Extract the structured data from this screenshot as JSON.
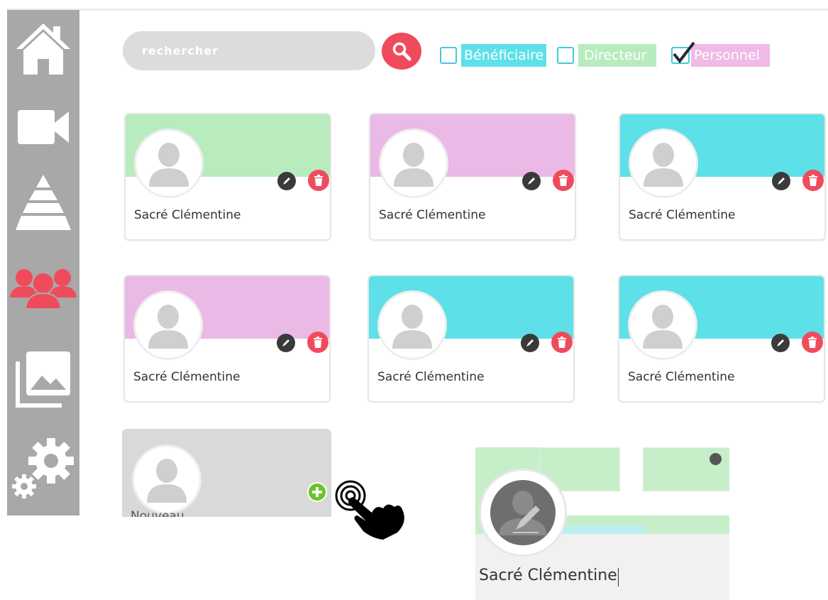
{
  "sidebar": {
    "items": [
      {
        "icon": "home-icon"
      },
      {
        "icon": "video-camera-icon"
      },
      {
        "icon": "pyramid-icon"
      },
      {
        "icon": "users-group-icon",
        "active": true
      },
      {
        "icon": "gallery-icon"
      },
      {
        "icon": "settings-gears-icon"
      }
    ],
    "active_color": "#f04b5c"
  },
  "search": {
    "placeholder": "rechercher",
    "button_icon": "search-icon"
  },
  "filters": [
    {
      "label": "Bénéficiaire",
      "checked": false,
      "color": "#5ee0ea"
    },
    {
      "label": "Directeur",
      "checked": false,
      "color": "#b8ecbe"
    },
    {
      "label": "Personnel",
      "checked": true,
      "color": "#f0b9e6"
    }
  ],
  "cards": [
    {
      "name": "Sacré Clémentine",
      "color": "#b8ecbe"
    },
    {
      "name": "Sacré Clémentine",
      "color": "#ebb9e6"
    },
    {
      "name": "Sacré Clémentine",
      "color": "#5ee0e8"
    },
    {
      "name": "Sacré Clémentine",
      "color": "#ebb9e6"
    },
    {
      "name": "Sacré Clémentine",
      "color": "#5ee0e8"
    },
    {
      "name": "Sacré Clémentine",
      "color": "#5ee0e8"
    }
  ],
  "new_card": {
    "name": "Nouveau",
    "add_icon": "plus-icon"
  },
  "popup": {
    "name": "Sacré Clémentine"
  },
  "colors": {
    "accent": "#f04b5c",
    "add": "#6bc32a",
    "sidebar": "#a8a8a8"
  }
}
